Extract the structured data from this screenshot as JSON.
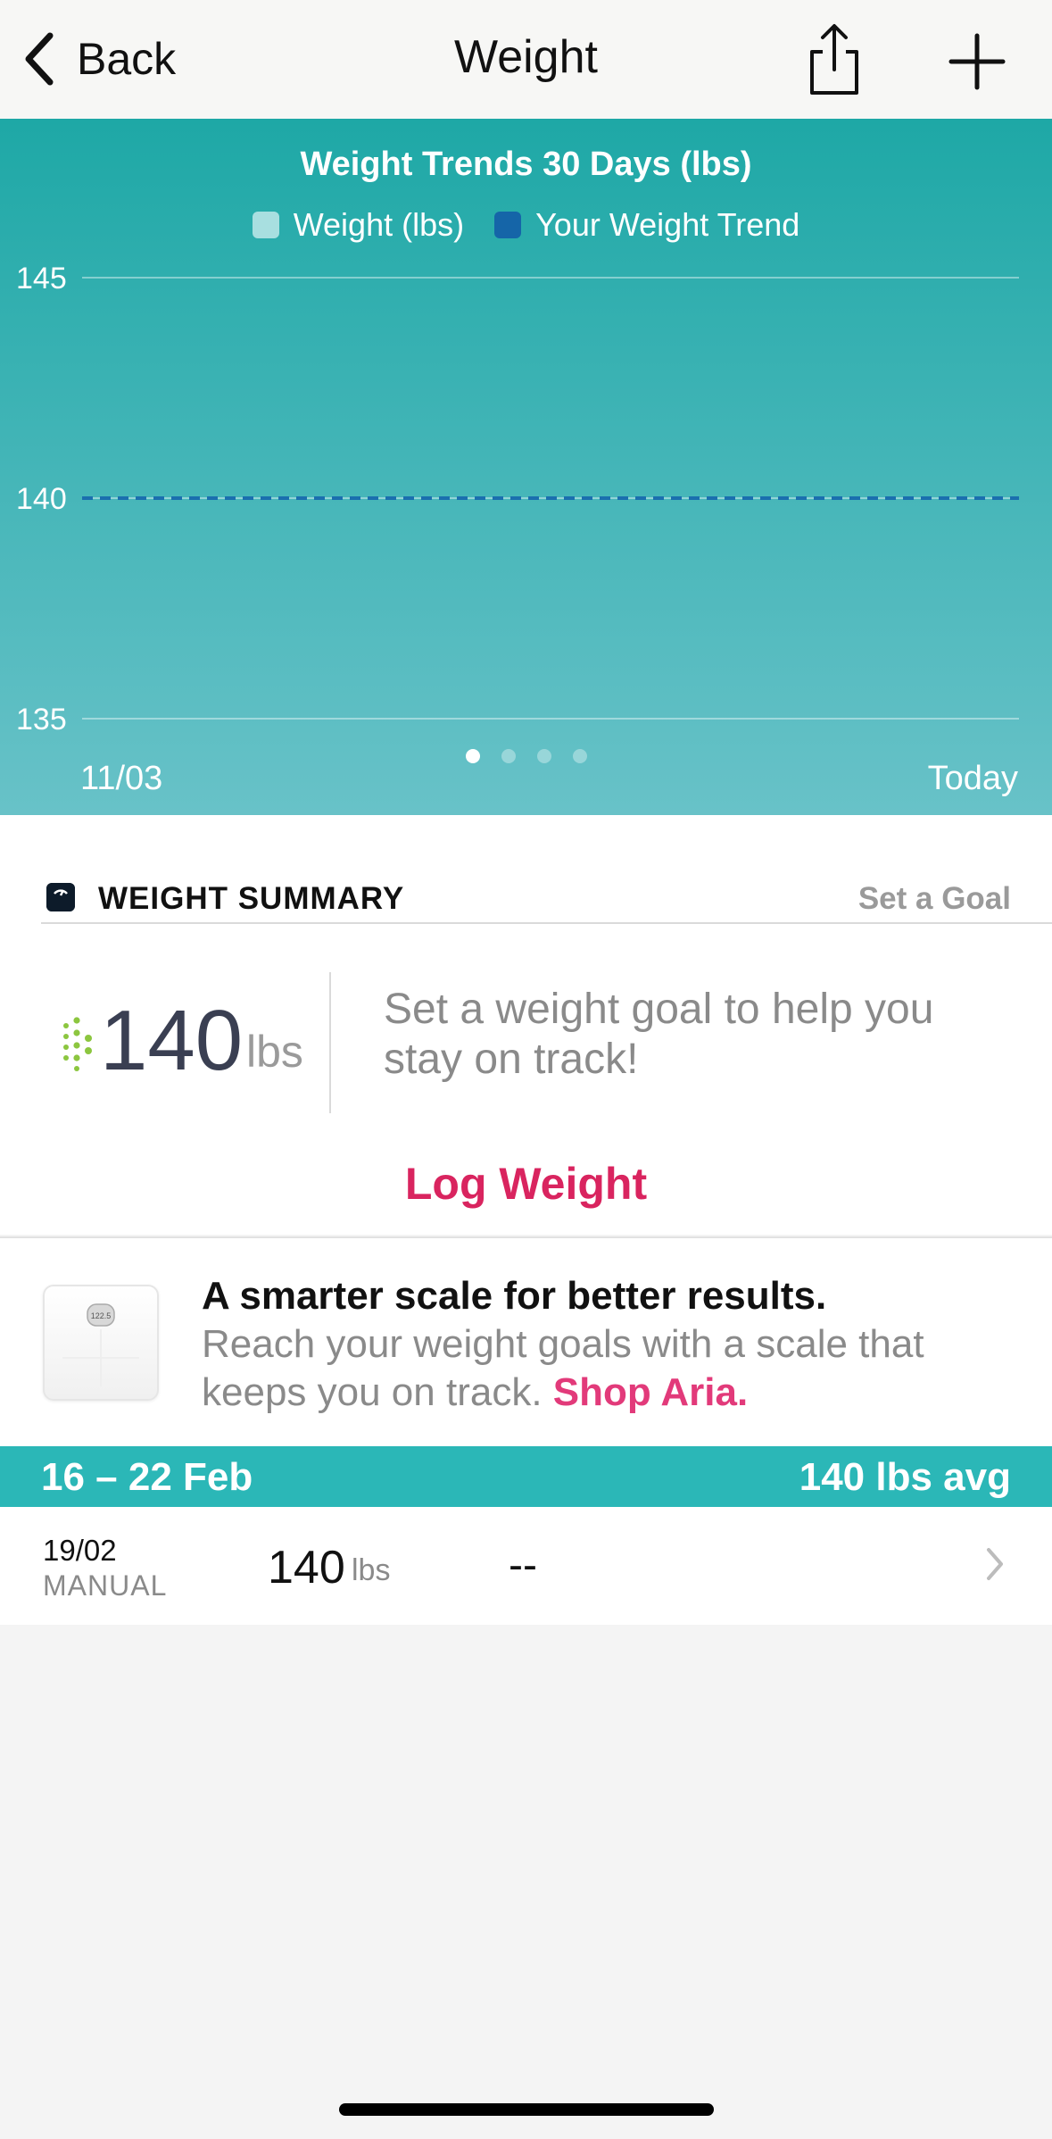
{
  "nav": {
    "back_label": "Back",
    "title": "Weight"
  },
  "chart_data": {
    "type": "line",
    "title": "Weight Trends 30 Days (lbs)",
    "legend": [
      "Weight (lbs)",
      "Your Weight Trend"
    ],
    "legend_colors": [
      "#a8dfe0",
      "#1565a8"
    ],
    "y_ticks": [
      "145",
      "140",
      "135"
    ],
    "ylim": [
      135,
      145
    ],
    "x_labels": [
      "11/03",
      "Today"
    ],
    "series": [
      {
        "name": "Your Weight Trend",
        "style": "dashed",
        "color": "#1a6fae",
        "x": [
          "11/03",
          "Today"
        ],
        "values": [
          140,
          140
        ]
      }
    ],
    "grid": true,
    "pager_pages": 4,
    "pager_active": 0
  },
  "summary": {
    "title": "WEIGHT SUMMARY",
    "goal_link": "Set a Goal",
    "value": "140",
    "unit": "lbs",
    "goal_text": "Set a weight goal to help you stay on track!",
    "log_button": "Log Weight"
  },
  "promo": {
    "title": "A smarter scale for better results.",
    "body": "Reach your weight goals with a scale that keeps you on track.",
    "link": "Shop Aria.",
    "scale_display": "122.5"
  },
  "week": {
    "range": "16 – 22 Feb",
    "avg": "140 lbs avg"
  },
  "entries": [
    {
      "date": "19/02",
      "source": "MANUAL",
      "value": "140",
      "unit": "lbs",
      "fat": "--"
    }
  ],
  "colors": {
    "accent_teal": "#2bb7b7",
    "accent_pink": "#d9245f"
  }
}
